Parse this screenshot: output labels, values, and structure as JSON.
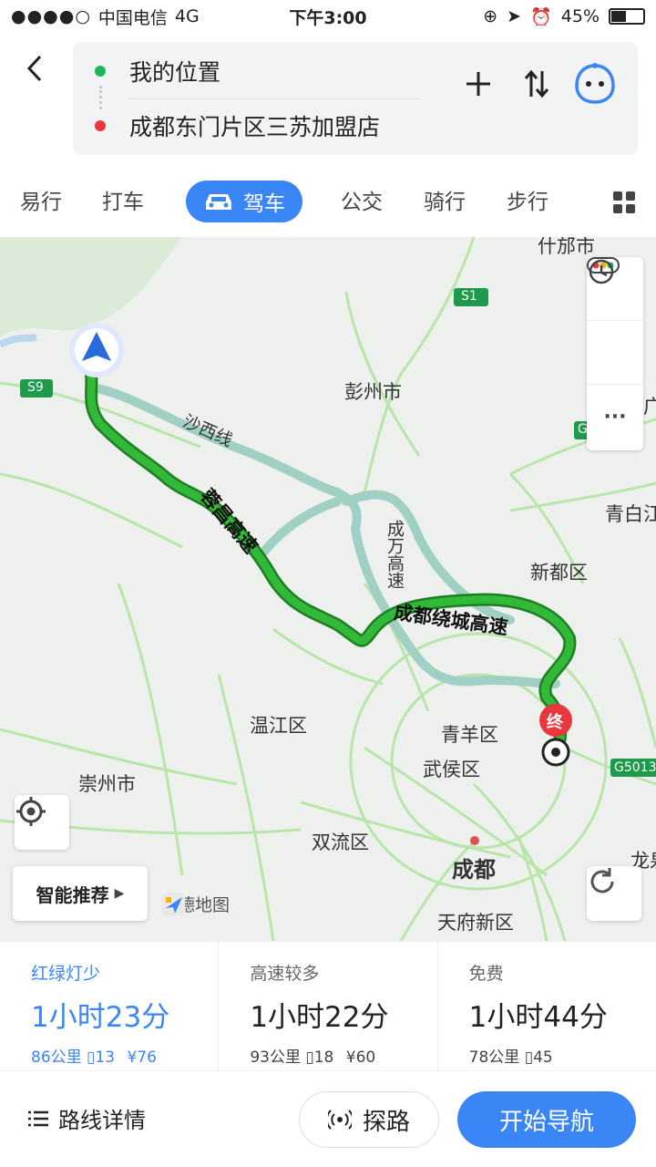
{
  "status_bar": {
    "carrier": "中国电信",
    "network": "4G",
    "time": "下午3:00",
    "battery": "45%"
  },
  "header": {
    "origin": "我的位置",
    "destination": "成都东门片区三苏加盟店"
  },
  "tabs": [
    {
      "label": "易行"
    },
    {
      "label": "打车"
    },
    {
      "label": "驾车",
      "active": true
    },
    {
      "label": "公交"
    },
    {
      "label": "骑行"
    },
    {
      "label": "步行"
    }
  ],
  "map": {
    "labels": {
      "shifang": "什邡市",
      "s1": "S1",
      "s9": "S9",
      "pengzhou": "彭州市",
      "shaxi": "沙西线",
      "chengwan": "成万高速",
      "qingbai": "青白江",
      "xindu": "新都区",
      "changhighway": "蓉昌高速",
      "ring": "成都绕城高速",
      "wenjiang": "温江区",
      "qingyang": "青羊区",
      "wuhou": "武侯区",
      "chongzhou": "崇州市",
      "shuangliu": "双流区",
      "chengdu": "成都",
      "tianfu": "天府新区",
      "g5013": "G5013",
      "end": "终",
      "long": "龙泉",
      "g": "G",
      "guang": "广"
    },
    "smart_recommend": "智能推荐",
    "logo_text": "高德地图"
  },
  "routes": [
    {
      "tag": "红绿灯少",
      "time": "1小时23分",
      "distance": "86公里",
      "lights": "13",
      "toll": "¥76"
    },
    {
      "tag": "高速较多",
      "time": "1小时22分",
      "distance": "93公里",
      "lights": "18",
      "toll": "¥60"
    },
    {
      "tag": "免费",
      "time": "1小时44分",
      "distance": "78公里",
      "lights": "45"
    }
  ],
  "bottom": {
    "detail": "路线详情",
    "probe": "探路",
    "start": "开始导航"
  },
  "colors": {
    "accent": "#3b86f7",
    "route_main": "#22a329",
    "route_alt": "#9fd0c3",
    "origin_dot": "#19b955",
    "dest_dot": "#e8383d"
  }
}
